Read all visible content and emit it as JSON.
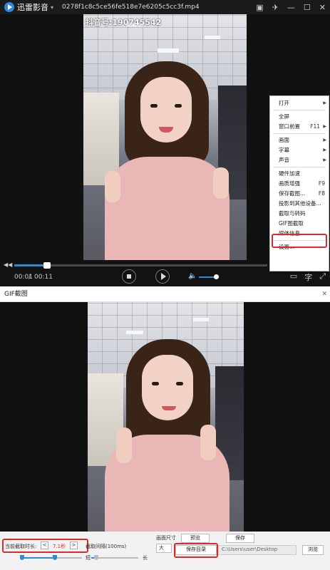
{
  "player": {
    "brand": "迅雷影音",
    "filename": "0278f1c8c5ce56fe518e7e6205c5cc3f.mp4",
    "watermark": "抖音号:190745542",
    "elapsed": "00:01",
    "duration": "00:11",
    "seek_progress": 0.13,
    "volume_level": 0.85
  },
  "context_menu": {
    "items": [
      {
        "label": "打开",
        "shortcut": "",
        "submenu": true
      },
      {
        "label": "全屏",
        "shortcut": "",
        "submenu": false
      },
      {
        "label": "窗口前置",
        "shortcut": "F11",
        "submenu": true
      },
      {
        "label": "画面",
        "shortcut": "",
        "submenu": true
      },
      {
        "label": "字幕",
        "shortcut": "",
        "submenu": true
      },
      {
        "label": "声音",
        "shortcut": "",
        "submenu": true
      },
      {
        "label": "硬件加速",
        "shortcut": "",
        "submenu": false
      },
      {
        "label": "画质增强",
        "shortcut": "F9",
        "submenu": false
      },
      {
        "label": "保存截图...",
        "shortcut": "F8",
        "submenu": false
      },
      {
        "label": "投影到其他设备...",
        "shortcut": "",
        "submenu": false
      },
      {
        "label": "截取与转码",
        "shortcut": "",
        "submenu": false
      },
      {
        "label": "GIF图截取",
        "shortcut": "",
        "submenu": false
      },
      {
        "label": "媒体信息...",
        "shortcut": "",
        "submenu": false
      },
      {
        "label": "设置...",
        "shortcut": "",
        "submenu": false
      }
    ],
    "highlighted_item": "GIF图截取"
  },
  "gif_dialog": {
    "title": "GIF截图",
    "duration_label": "当前截取时长:",
    "duration_value": "7.1秒",
    "prev_label": "<",
    "next_label": ">",
    "interval_label": "截取间隔(100ms)",
    "short_label": "短",
    "long_label": "长",
    "size_label": "画面尺寸",
    "size_value": "大",
    "preview_button": "预览",
    "save_button": "保存",
    "save_dir_button": "保存目录",
    "save_path": "C:\\Users\\user\\Desktop",
    "browse_button": "浏览",
    "duration_slider": 0.55,
    "interval_slider": 0.1
  },
  "colors": {
    "accent": "#2f8bd8",
    "highlight": "#d62d2d"
  }
}
